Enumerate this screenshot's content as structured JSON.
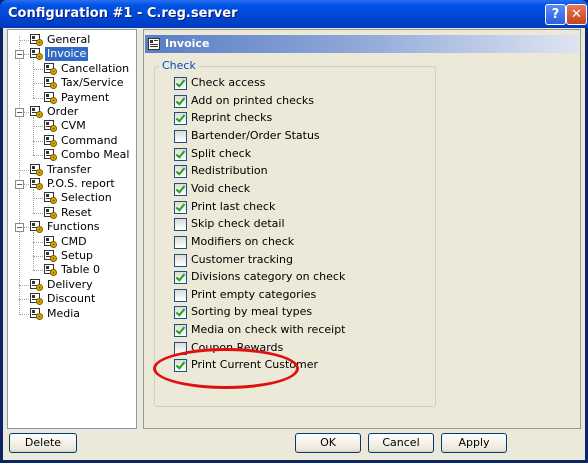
{
  "window": {
    "title": "Configuration #1 - C.reg.server",
    "help_glyph": "?",
    "close_glyph": "✕"
  },
  "tree": {
    "items": [
      {
        "id": "general",
        "label": "General",
        "level": 1
      },
      {
        "id": "invoice",
        "label": "Invoice",
        "level": 1,
        "expanded": true,
        "selected": true
      },
      {
        "id": "cancellation",
        "label": "Cancellation",
        "level": 2
      },
      {
        "id": "tax-service",
        "label": "Tax/Service",
        "level": 2
      },
      {
        "id": "payment",
        "label": "Payment",
        "level": 2
      },
      {
        "id": "order",
        "label": "Order",
        "level": 1,
        "expanded": true
      },
      {
        "id": "cvm",
        "label": "CVM",
        "level": 2
      },
      {
        "id": "command",
        "label": "Command",
        "level": 2
      },
      {
        "id": "combo-meal",
        "label": "Combo Meal",
        "level": 2
      },
      {
        "id": "transfer",
        "label": "Transfer",
        "level": 1
      },
      {
        "id": "pos-report",
        "label": "P.O.S. report",
        "level": 1,
        "expanded": true
      },
      {
        "id": "selection",
        "label": "Selection",
        "level": 2
      },
      {
        "id": "reset",
        "label": "Reset",
        "level": 2
      },
      {
        "id": "functions",
        "label": "Functions",
        "level": 1,
        "expanded": true
      },
      {
        "id": "cmd",
        "label": "CMD",
        "level": 2
      },
      {
        "id": "setup",
        "label": "Setup",
        "level": 2
      },
      {
        "id": "table-0",
        "label": "Table 0",
        "level": 2
      },
      {
        "id": "delivery",
        "label": "Delivery",
        "level": 1
      },
      {
        "id": "discount",
        "label": "Discount",
        "level": 1
      },
      {
        "id": "media",
        "label": "Media",
        "level": 1
      }
    ]
  },
  "panel": {
    "title": "Invoice",
    "group_label": "Check",
    "checkboxes": [
      {
        "label": "Check access",
        "checked": true
      },
      {
        "label": "Add on printed checks",
        "checked": true
      },
      {
        "label": "Reprint checks",
        "checked": true
      },
      {
        "label": "Bartender/Order Status",
        "checked": false
      },
      {
        "label": "Split check",
        "checked": true
      },
      {
        "label": "Redistribution",
        "checked": true
      },
      {
        "label": "Void check",
        "checked": true
      },
      {
        "label": "Print last check",
        "checked": true
      },
      {
        "label": "Skip check detail",
        "checked": false
      },
      {
        "label": "Modifiers on check",
        "checked": false
      },
      {
        "label": "Customer tracking",
        "checked": false
      },
      {
        "label": "Divisions category on check",
        "checked": true
      },
      {
        "label": "Print empty categories",
        "checked": false
      },
      {
        "label": "Sorting by meal types",
        "checked": true
      },
      {
        "label": "Media on check with receipt",
        "checked": true
      },
      {
        "label": "Coupon Rewards",
        "checked": false
      },
      {
        "label": "Print Current Customer",
        "checked": true
      }
    ]
  },
  "buttons": {
    "delete": "Delete",
    "ok": "OK",
    "cancel": "Cancel",
    "apply": "Apply"
  },
  "colors": {
    "highlight_ring": "#e01010",
    "selection": "#316ac5",
    "group_label": "#0046d5"
  }
}
